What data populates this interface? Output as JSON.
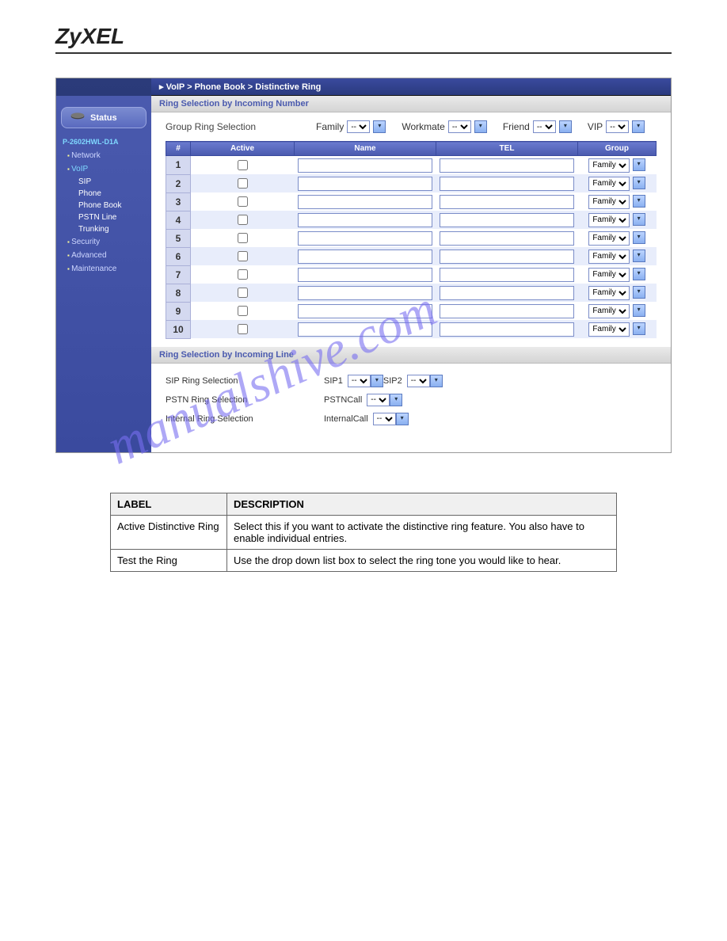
{
  "brand": "ZyXEL",
  "breadcrumb": {
    "p1": "VoIP",
    "p2": "Phone Book",
    "p3": "Distinctive Ring"
  },
  "sidebar": {
    "status": "Status",
    "device": "P-2602HWL-D1A",
    "items": [
      {
        "label": "Network",
        "active": false
      },
      {
        "label": "VoIP",
        "active": true
      },
      {
        "label": "Security",
        "active": false
      },
      {
        "label": "Advanced",
        "active": false
      },
      {
        "label": "Maintenance",
        "active": false
      }
    ],
    "voip_subs": [
      {
        "label": "SIP"
      },
      {
        "label": "Phone"
      },
      {
        "label": "Phone Book"
      },
      {
        "label": "PSTN Line"
      },
      {
        "label": "Trunking"
      }
    ]
  },
  "section1": {
    "title": "Ring Selection by Incoming Number",
    "group_label": "Group Ring Selection",
    "groups": [
      {
        "name": "Family",
        "val": "--"
      },
      {
        "name": "Workmate",
        "val": "--"
      },
      {
        "name": "Friend",
        "val": "--"
      },
      {
        "name": "VIP",
        "val": "--"
      }
    ],
    "cols": {
      "num": "#",
      "active": "Active",
      "name": "Name",
      "tel": "TEL",
      "group": "Group"
    },
    "rows": [
      {
        "n": "1",
        "group": "Family"
      },
      {
        "n": "2",
        "group": "Family"
      },
      {
        "n": "3",
        "group": "Family"
      },
      {
        "n": "4",
        "group": "Family"
      },
      {
        "n": "5",
        "group": "Family"
      },
      {
        "n": "6",
        "group": "Family"
      },
      {
        "n": "7",
        "group": "Family"
      },
      {
        "n": "8",
        "group": "Family"
      },
      {
        "n": "9",
        "group": "Family"
      },
      {
        "n": "10",
        "group": "Family"
      }
    ]
  },
  "section2": {
    "title": "Ring Selection by Incoming Line",
    "rows": [
      {
        "label": "SIP Ring Selection",
        "items": [
          {
            "name": "SIP1",
            "val": "--"
          },
          {
            "name": "SIP2",
            "val": "--"
          }
        ]
      },
      {
        "label": "PSTN Ring Selection",
        "items": [
          {
            "name": "PSTNCall",
            "val": "--"
          }
        ]
      },
      {
        "label": "Internal Ring Selection",
        "items": [
          {
            "name": "InternalCall",
            "val": "--"
          }
        ]
      }
    ]
  },
  "desc": {
    "h1": "LABEL",
    "h2": "DESCRIPTION",
    "rows": [
      {
        "l": "Active Distinctive Ring",
        "d": "Select this if you want to activate the distinctive ring feature. You also have to enable individual entries."
      },
      {
        "l": "Test the Ring",
        "d": "Use the drop down list box to select the ring tone you would like to hear."
      }
    ]
  },
  "watermark": "manualshive.com"
}
